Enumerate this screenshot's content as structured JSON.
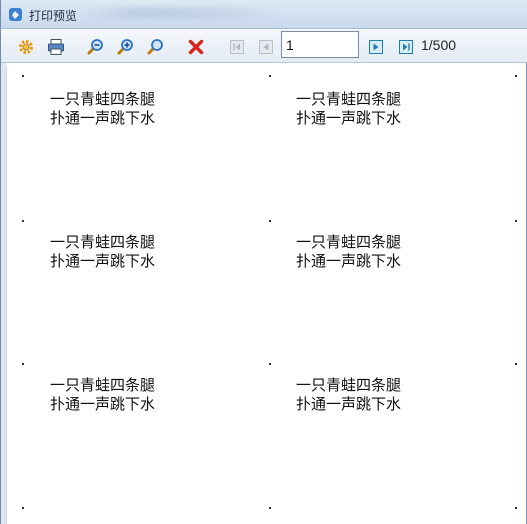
{
  "window": {
    "title": "打印预览"
  },
  "toolbar": {
    "buttons": [
      {
        "name": "settings-icon"
      },
      {
        "name": "print-icon"
      },
      {
        "name": "zoom-out-icon"
      },
      {
        "name": "zoom-in-icon"
      },
      {
        "name": "zoom-fit-icon"
      },
      {
        "name": "close-icon"
      },
      {
        "name": "first-page-icon"
      },
      {
        "name": "prev-page-icon"
      },
      {
        "name": "next-page-icon"
      },
      {
        "name": "last-page-icon"
      }
    ],
    "page_input_value": "1",
    "page_count": "1/500"
  },
  "labels": [
    {
      "line1": "一只青蛙四条腿",
      "line2": "扑通一声跳下水"
    },
    {
      "line1": "一只青蛙四条腿",
      "line2": "扑通一声跳下水"
    },
    {
      "line1": "一只青蛙四条腿",
      "line2": "扑通一声跳下水"
    },
    {
      "line1": "一只青蛙四条腿",
      "line2": "扑通一声跳下水"
    },
    {
      "line1": "一只青蛙四条腿",
      "line2": "扑通一声跳下水"
    },
    {
      "line1": "一只青蛙四条腿",
      "line2": "扑通一声跳下水"
    }
  ],
  "colors": {
    "accent_blue": "#2b73c9",
    "close_red": "#d9261c",
    "nav_teal": "#1f7fa8",
    "settings_orange": "#e59a12"
  }
}
